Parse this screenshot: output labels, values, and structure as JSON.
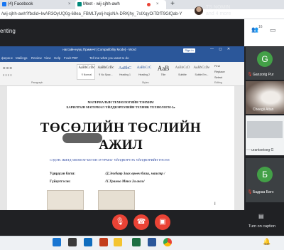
{
  "browser": {
    "tabs": [
      {
        "label": "(4) Facebook",
        "close": "×"
      },
      {
        "label": "Meet - wij-sjhh-awh",
        "close": "×"
      }
    ],
    "new_tab": "+",
    "url": "/wij-sjhh-awh?fbclid=IwAR3OyUQ0g-68ea_FBMLTyelj-hqjsNA-DRKjhy_7sIXqyOiTDfT9GlQab-Y"
  },
  "meet": {
    "presenting_label": "enting",
    "presenter_name": "TS NOMIN",
    "presenter_more": "and 4 more",
    "people_count": "16",
    "participants": [
      {
        "initial": "G",
        "name": "Ganzorig Pur",
        "color": "#43a047"
      },
      {
        "name": "Cheegii Altan"
      },
      {
        "name": "urantsetseg G"
      },
      {
        "initial": "Б",
        "name": "Бадраа Батх",
        "color": "#43a047"
      }
    ],
    "captions_label": "Turn on caption"
  },
  "word": {
    "window_title": "нагсайн-нууц Примечт [Compatibility Mode] - Word",
    "signin": "Sign in",
    "window_buttons": "—  ◻  ✕",
    "menu": [
      "ференс",
      "Mailings",
      "Review",
      "View",
      "Help",
      "Foxit PDF",
      "Tell me what you want to do"
    ],
    "styles": [
      {
        "sample": "AaBbCcDc",
        "name": "¶ Normal"
      },
      {
        "sample": "AaBbCcDc",
        "name": "¶ No Spac..."
      },
      {
        "sample": "AaBbC",
        "name": "Heading 1"
      },
      {
        "sample": "AaBbCcC",
        "name": "Heading 2"
      },
      {
        "sample": "AaB",
        "name": "Title"
      },
      {
        "sample": "AaBbCcD",
        "name": "Subtitle"
      },
      {
        "sample": "AaBbCcDe",
        "name": "Subtle Em..."
      }
    ],
    "ribbon_groups": {
      "paragraph": "Paragraph",
      "styles": "Styles",
      "editing": "Editing"
    },
    "editing": [
      "Find",
      "Replace",
      "Select"
    ],
    "doc": {
      "line1": "МАТЕРИАЛЫН ТЕХНОЛОГИЙН ТЭНХИМ",
      "line2": "БАРИЛГЫН МАТЕРИАЛ ҮЙЛДВЭРЛЭЛИЙН ТЕХНИК ТЕХНОЛОГИ-2a",
      "title1": "ТӨСӨЛИЙН ТӨСЛИЙН",
      "title2": "АЖИЛ",
      "topic": "СЭДЭВ: ЖИЛД 500000 М³ БЕТОН ЗУУРМАГ ҮЙЛДВЭРТЭХ ҮЙЛДВЭРИЙН ТӨСӨЛ",
      "advisor_label": "Удирдсан багш:",
      "advisor_value": "/Д.Энхбаяр Заах өрөөч багш, маистр /",
      "student_label": "Гүйцэтгэсэн:",
      "student_value": "/Х.Урамоо Мтех 2а анги/"
    }
  },
  "controls": {
    "mic": "mic-off",
    "end": "end-call",
    "cam": "cam-off"
  },
  "colors": {
    "word_blue": "#2b579a",
    "meet_red": "#ea4335",
    "meet_bg": "#202124",
    "avatar_green": "#43a047"
  }
}
